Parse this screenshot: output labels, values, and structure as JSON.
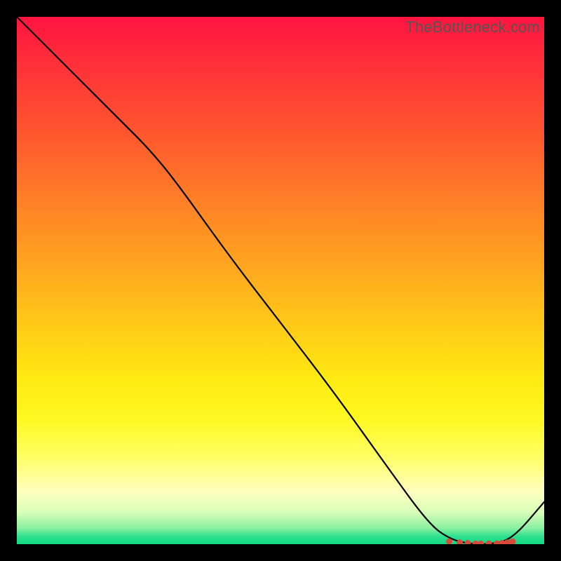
{
  "watermark": "TheBottleneck.com",
  "chart_data": {
    "type": "line",
    "title": "",
    "xlabel": "",
    "ylabel": "",
    "xlim": [
      0,
      100
    ],
    "ylim": [
      0,
      100
    ],
    "grid": false,
    "legend": false,
    "series": [
      {
        "name": "curve",
        "x": [
          0,
          10,
          20,
          25,
          30,
          40,
          50,
          60,
          70,
          78,
          82,
          86,
          90,
          94,
          100
        ],
        "y": [
          100,
          90,
          80,
          75,
          69,
          55,
          42,
          29,
          15,
          4,
          1,
          0,
          0,
          1,
          8
        ]
      }
    ],
    "markers": {
      "name": "bottom-dots",
      "color": "#d84a3a",
      "x": [
        82,
        84,
        85.5,
        87,
        88,
        89.5,
        91,
        92,
        93,
        94
      ],
      "y": [
        0.5,
        0.3,
        0.2,
        0.1,
        0.1,
        0.1,
        0.1,
        0.2,
        0.3,
        0.5
      ]
    }
  }
}
